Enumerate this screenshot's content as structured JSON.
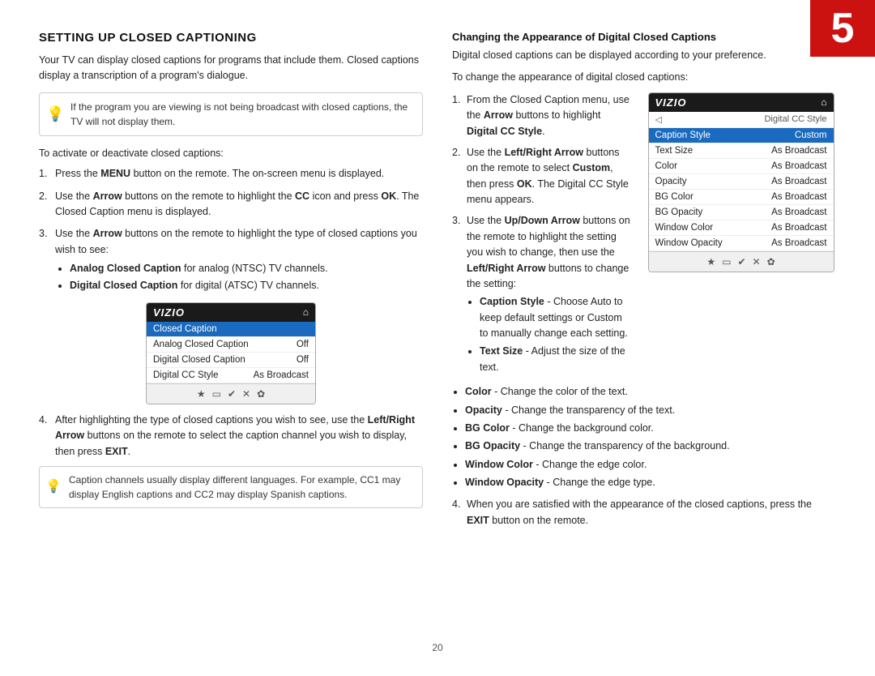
{
  "page": {
    "number": "5",
    "page_num_display": "20"
  },
  "left_col": {
    "title": "SETTING UP CLOSED CAPTIONING",
    "intro": "Your TV can display closed captions for programs that include them. Closed captions display a transcription of a program's dialogue.",
    "info_box": "If the program you are viewing is not being broadcast with closed captions, the TV will not display them.",
    "steps": [
      {
        "num": "1.",
        "text_parts": [
          {
            "text": "Press the ",
            "bold": false
          },
          {
            "text": "MENU",
            "bold": true
          },
          {
            "text": " button on the remote. The on-screen menu is displayed.",
            "bold": false
          }
        ]
      },
      {
        "num": "2.",
        "text_parts": [
          {
            "text": "Use the ",
            "bold": false
          },
          {
            "text": "Arrow",
            "bold": true
          },
          {
            "text": " buttons on the remote to highlight the ",
            "bold": false
          },
          {
            "text": "CC",
            "bold": true
          },
          {
            "text": " icon and press ",
            "bold": false
          },
          {
            "text": "OK",
            "bold": true
          },
          {
            "text": ". The Closed Caption menu is displayed.",
            "bold": false
          }
        ]
      },
      {
        "num": "3.",
        "text_parts": [
          {
            "text": "Use the ",
            "bold": false
          },
          {
            "text": "Arrow",
            "bold": true
          },
          {
            "text": " buttons on the remote to highlight the type of closed captions you wish to see:",
            "bold": false
          }
        ],
        "bullets": [
          {
            "bold_part": "Analog Closed Caption",
            "rest": " for analog (NTSC) TV channels."
          },
          {
            "bold_part": "Digital Closed Caption",
            "rest": " for digital (ATSC) TV channels."
          }
        ]
      },
      {
        "num": "4.",
        "text_parts": [
          {
            "text": "After highlighting the type of closed captions you wish to see, use the ",
            "bold": false
          },
          {
            "text": "Left/Right Arrow",
            "bold": true
          },
          {
            "text": " buttons on the remote to select the caption channel you wish to display, then press ",
            "bold": false
          },
          {
            "text": "EXIT",
            "bold": true
          },
          {
            "text": ".",
            "bold": false
          }
        ]
      }
    ],
    "tv_left": {
      "logo": "VIZIO",
      "menu_rows": [
        {
          "label": "Closed Caption",
          "value": "",
          "selected": true,
          "is_header": false
        },
        {
          "label": "Analog Closed Caption",
          "value": "Off",
          "selected": false
        },
        {
          "label": "Digital Closed Caption",
          "value": "Off",
          "selected": false
        },
        {
          "label": "Digital CC Style",
          "value": "As Broadcast",
          "selected": false
        }
      ],
      "footer_buttons": [
        "★",
        "▭",
        "✔",
        "✕",
        "✿"
      ]
    },
    "bottom_info": "Caption channels usually display different languages. For example, CC1 may display English captions and CC2 may display Spanish captions."
  },
  "right_col": {
    "subsection_title": "Changing the Appearance of Digital Closed Captions",
    "intro": "Digital closed captions can be displayed according to your preference.",
    "step_intro": "To change the appearance of digital closed captions:",
    "steps": [
      {
        "num": "1.",
        "text_parts": [
          {
            "text": "From the Closed Caption menu, use the ",
            "bold": false
          },
          {
            "text": "Arrow",
            "bold": true
          },
          {
            "text": " buttons to highlight ",
            "bold": false
          },
          {
            "text": "Digital CC Style",
            "bold": true
          },
          {
            "text": ".",
            "bold": false
          }
        ]
      },
      {
        "num": "2.",
        "text_parts": [
          {
            "text": "Use the ",
            "bold": false
          },
          {
            "text": "Left/Right Arrow",
            "bold": true
          },
          {
            "text": " buttons on the remote to select ",
            "bold": false
          },
          {
            "text": "Custom",
            "bold": true
          },
          {
            "text": ", then press ",
            "bold": false
          },
          {
            "text": "OK",
            "bold": true
          },
          {
            "text": ". The Digital CC Style menu appears.",
            "bold": false
          }
        ]
      },
      {
        "num": "3.",
        "text_parts": [
          {
            "text": "Use the ",
            "bold": false
          },
          {
            "text": "Up/Down Arrow",
            "bold": true
          },
          {
            "text": " buttons on the remote to highlight the setting you wish to change, then use the ",
            "bold": false
          },
          {
            "text": "Left/Right Arrow",
            "bold": true
          },
          {
            "text": " buttons to change the setting:",
            "bold": false
          }
        ],
        "bullets": [
          {
            "bold_part": "Caption Style",
            "rest": " - Choose Auto to keep default settings or Custom to manually change each setting."
          },
          {
            "bold_part": "Text Size",
            "rest": " - Adjust the size of the text."
          }
        ]
      }
    ],
    "bottom_bullets": [
      {
        "bold_part": "Color",
        "rest": " - Change the color of the text."
      },
      {
        "bold_part": "Opacity",
        "rest": " - Change the transparency of the text."
      },
      {
        "bold_part": "BG Color",
        "rest": " - Change the background color."
      },
      {
        "bold_part": "BG Opacity",
        "rest": " - Change the transparency of the background."
      },
      {
        "bold_part": "Window Color",
        "rest": " - Change the edge color."
      },
      {
        "bold_part": "Window Opacity",
        "rest": " - Change the edge type."
      }
    ],
    "step4_text_parts": [
      {
        "text": "When you are satisfied with the appearance of the closed captions, press the ",
        "bold": false
      },
      {
        "text": "EXIT",
        "bold": true
      },
      {
        "text": " button on the remote.",
        "bold": false
      }
    ],
    "step4_num": "4.",
    "tv_right": {
      "logo": "VIZIO",
      "menu_rows": [
        {
          "label": "Digital CC Style",
          "value": "",
          "is_back": true
        },
        {
          "label": "Caption Style",
          "value": "Custom",
          "selected": true
        },
        {
          "label": "Text Size",
          "value": "As Broadcast"
        },
        {
          "label": "Color",
          "value": "As Broadcast"
        },
        {
          "label": "Opacity",
          "value": "As Broadcast"
        },
        {
          "label": "BG Color",
          "value": "As Broadcast"
        },
        {
          "label": "BG Opacity",
          "value": "As Broadcast"
        },
        {
          "label": "Window Color",
          "value": "As Broadcast"
        },
        {
          "label": "Window Opacity",
          "value": "As Broadcast"
        }
      ],
      "footer_buttons": [
        "★",
        "▭",
        "✔",
        "✕",
        "✿"
      ]
    }
  }
}
